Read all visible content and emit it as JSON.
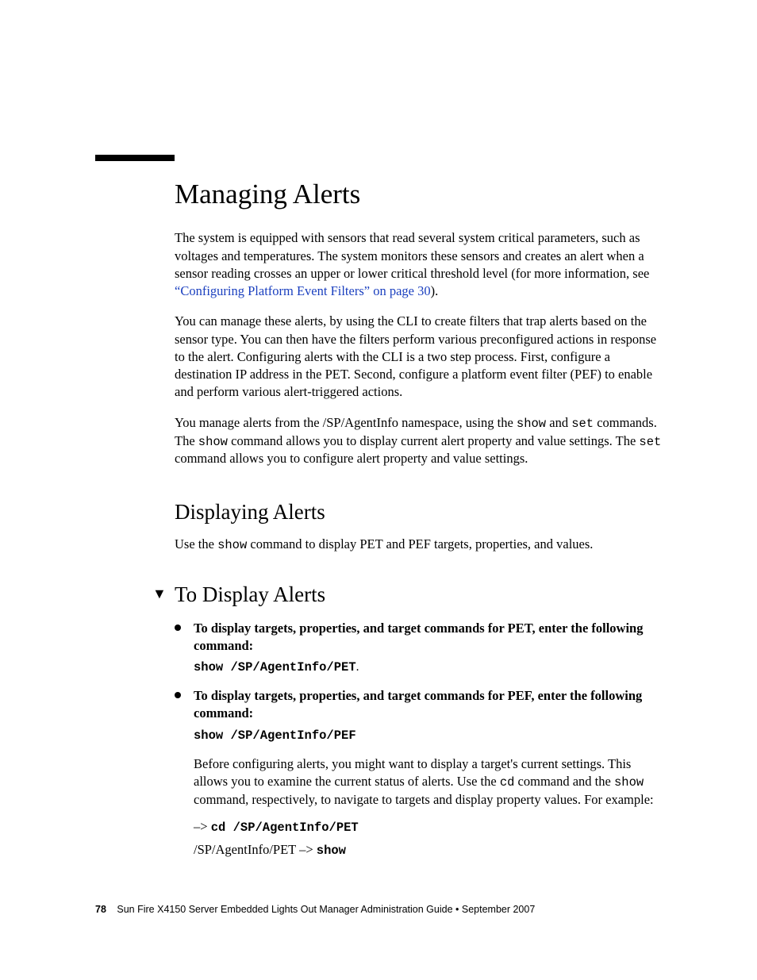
{
  "heading": "Managing Alerts",
  "intro": {
    "p1_a": "The system is equipped with sensors that read several system critical parameters, such as voltages and temperatures. The system monitors these sensors and creates an alert when a sensor reading crosses an upper or lower critical threshold level (for more information, see ",
    "xref": "“Configuring Platform Event Filters” on page 30",
    "p1_b": ").",
    "p2": "You can manage these alerts, by using the CLI to create filters that trap alerts based on the sensor type. You can then have the filters perform various preconfigured actions in response to the alert. Configuring alerts with the CLI is a two step process. First, configure a destination IP address in the PET. Second, configure a platform event filter (PEF) to enable and perform various alert-triggered actions.",
    "p3_a": "You manage alerts from the /SP/AgentInfo namespace, using the ",
    "p3_cmd1": "show",
    "p3_b": " and ",
    "p3_cmd2": "set",
    "p3_c": " commands. The ",
    "p3_cmd3": "show",
    "p3_d": " command allows you to display current alert property and value settings. The ",
    "p3_cmd4": "set",
    "p3_e": " command allows you to configure alert property and value settings."
  },
  "section2": {
    "title": "Displaying Alerts",
    "p_a": "Use the ",
    "p_cmd": "show",
    "p_b": " command to display PET and PEF targets, properties, and values."
  },
  "section3": {
    "title": "To Display Alerts",
    "marker": "▼",
    "items": [
      {
        "lead": "To display targets, properties, and target commands for PET, enter the following command:",
        "cmd": "show /SP/AgentInfo/PET",
        "period": "."
      },
      {
        "lead": "To display targets, properties, and target commands for PEF, enter the following command:",
        "cmd": "show /SP/AgentInfo/PEF",
        "body_a": "Before configuring alerts, you might want to display a target's current settings. This allows you to examine the current status of alerts. Use the ",
        "body_cmd1": "cd",
        "body_b": " command and the ",
        "body_cmd2": "show",
        "body_c": " command, respectively, to navigate to targets and display property values. For example:",
        "ex1_prompt": "–> ",
        "ex1_cmd": "cd /SP/AgentInfo/PET",
        "ex2_path": "/SP/AgentInfo/PET –> ",
        "ex2_cmd": "show"
      }
    ]
  },
  "footer": {
    "page": "78",
    "title": "Sun Fire X4150 Server Embedded Lights Out Manager Administration Guide • September 2007"
  }
}
